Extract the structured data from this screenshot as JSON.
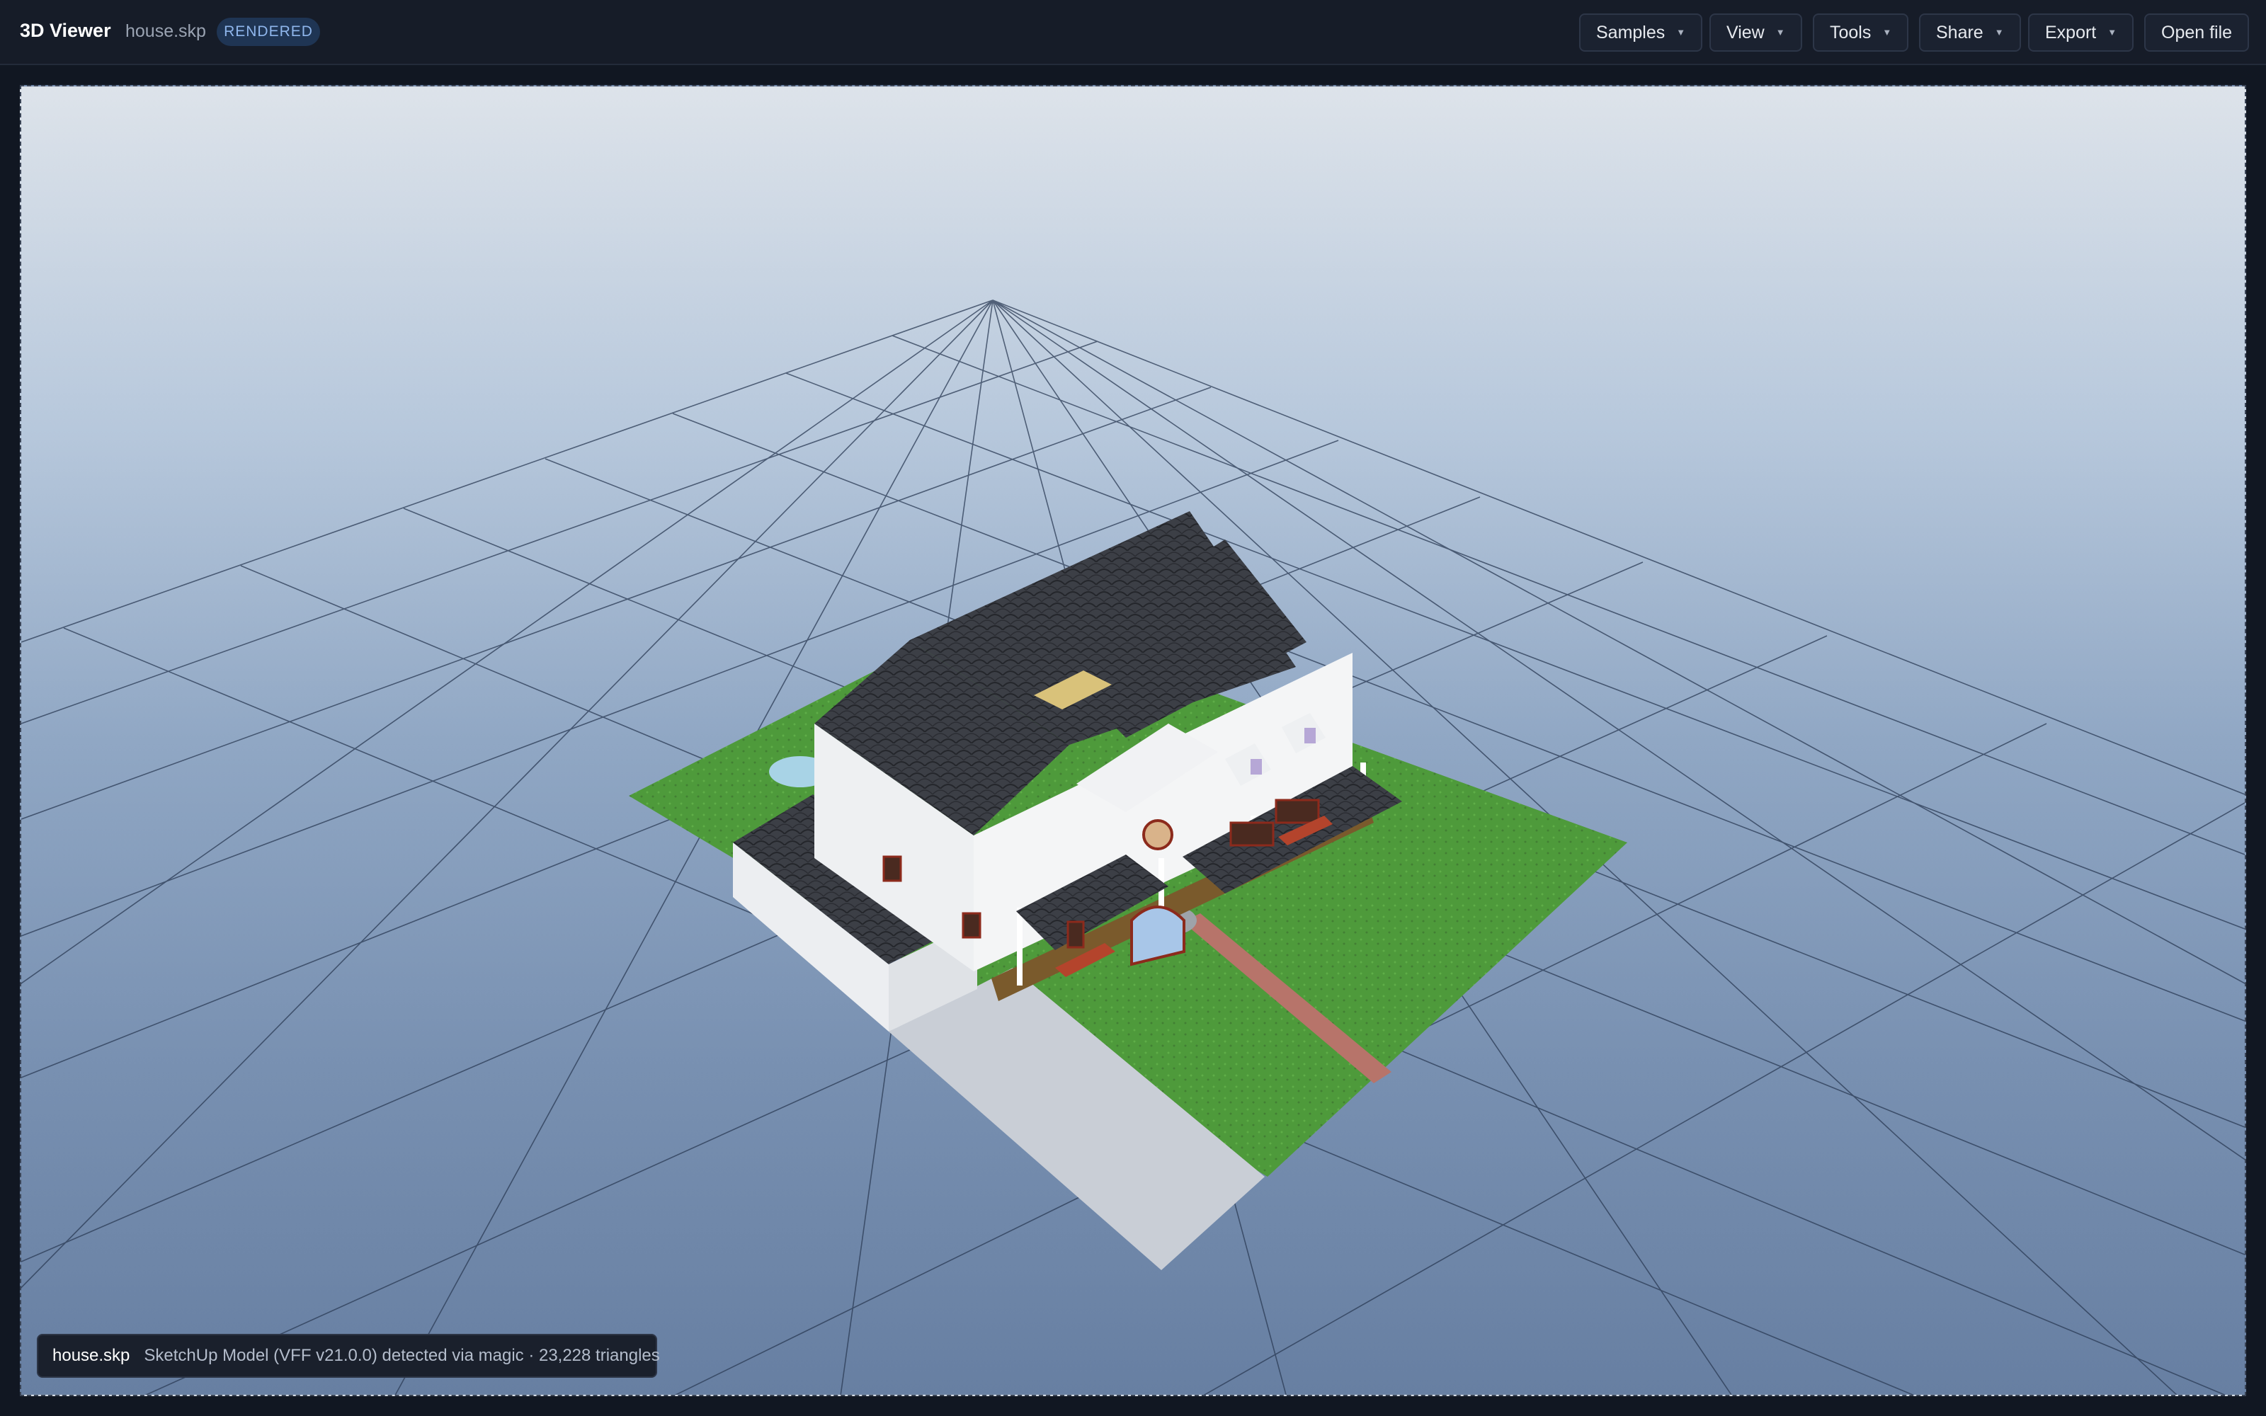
{
  "header": {
    "app_title": "3D Viewer",
    "file_name": "house.skp",
    "status_badge": "RENDERED",
    "menus": [
      {
        "label": "Samples"
      },
      {
        "label": "View"
      },
      {
        "label": "Tools"
      },
      {
        "label": "Share"
      },
      {
        "label": "Export"
      }
    ],
    "open_file_label": "Open file"
  },
  "viewport": {
    "model": "house",
    "ground_grid": true
  },
  "status_bar": {
    "file": "house.skp",
    "info": "SketchUp Model (VFF v21.0.0) detected via magic · 23,228 triangles"
  },
  "colors": {
    "accent_badge_bg": "#1f3554",
    "accent_badge_text": "#8fb6ec",
    "grass": "#4f9a3a",
    "roof": "#3b3e45",
    "walls": "#eef0f2",
    "trim": "#8c2a1c",
    "driveway": "#c9ced6",
    "path": "#b7746a"
  }
}
